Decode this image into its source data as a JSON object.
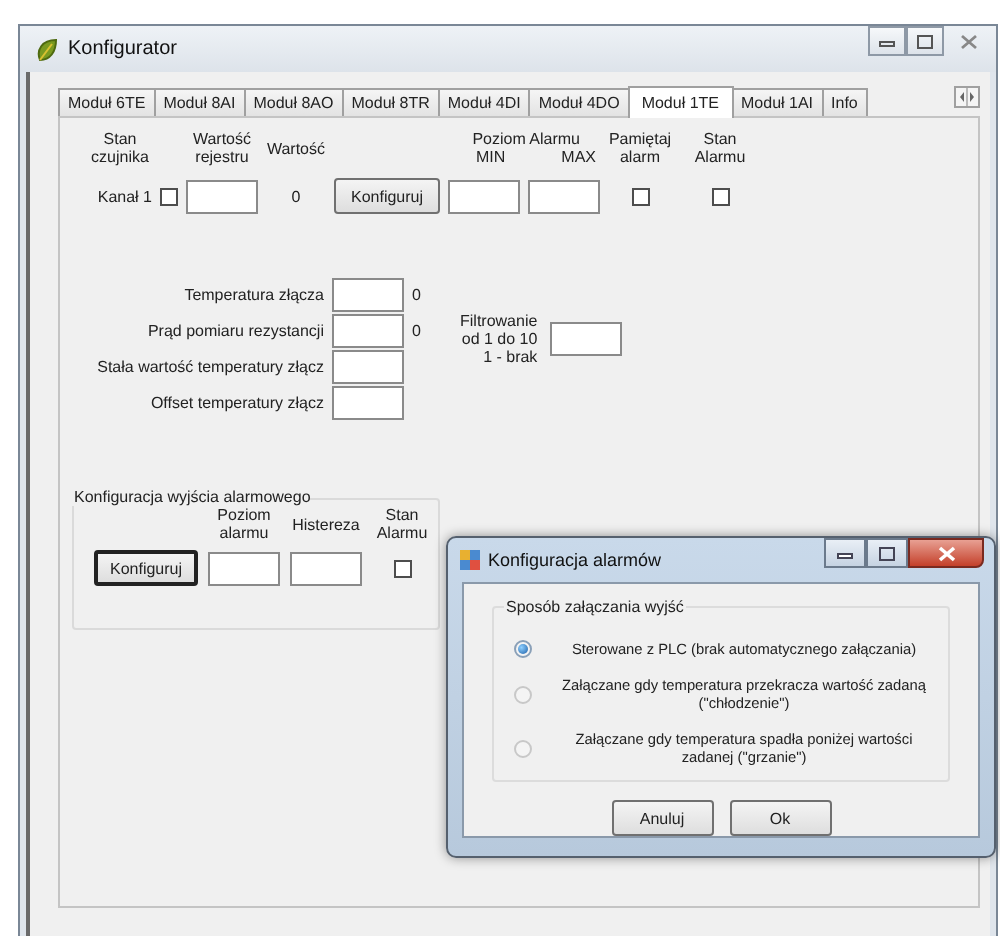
{
  "window": {
    "title": "Konfigurator"
  },
  "tabs": [
    {
      "label": "Moduł 6TE",
      "selected": false
    },
    {
      "label": "Moduł 8AI",
      "selected": false
    },
    {
      "label": "Moduł 8AO",
      "selected": false
    },
    {
      "label": "Moduł 8TR",
      "selected": false
    },
    {
      "label": "Moduł 4DI",
      "selected": false
    },
    {
      "label": "Moduł 4DO",
      "selected": false
    },
    {
      "label": "Moduł 1TE",
      "selected": true
    },
    {
      "label": "Moduł 1AI",
      "selected": false
    },
    {
      "label": "Info",
      "selected": false
    }
  ],
  "channel_section": {
    "headers": {
      "sensor_state": "Stan\nczujnika",
      "register_value": "Wartość\nrejestru",
      "value": "Wartość",
      "alarm_level": "Poziom Alarmu",
      "min": "MIN",
      "max": "MAX",
      "remember_alarm": "Pamiętaj\nalarm",
      "alarm_state": "Stan\nAlarmu"
    },
    "channel_label": "Kanał 1",
    "sensor_checked": false,
    "value": "0",
    "configure_button": "Konfiguruj",
    "remember_checked": false,
    "alarm_state_checked": false
  },
  "junction_section": {
    "fields": [
      {
        "label": "Temperatura złącza",
        "reading": "0"
      },
      {
        "label": "Prąd pomiaru rezystancji",
        "reading": "0"
      },
      {
        "label": "Stała wartość temperatury złącz"
      },
      {
        "label": "Offset temperatury złącz"
      }
    ],
    "filter_label": "Filtrowanie\nod 1 do 10\n1 - brak"
  },
  "alarm_output": {
    "title": "Konfiguracja wyjścia alarmowego",
    "level_header": "Poziom\nalarmu",
    "hysteresis_header": "Histereza",
    "state_header": "Stan\nAlarmu",
    "configure_button": "Konfiguruj",
    "state_checked": false
  },
  "dialog": {
    "title": "Konfiguracja alarmów",
    "group_title": "Sposób załączania wyjść",
    "options": [
      {
        "label": "Sterowane z PLC (brak automatycznego załączania)",
        "selected": true
      },
      {
        "label": "Załączane gdy temperatura przekracza wartość zadaną\n(\"chłodzenie\")",
        "selected": false
      },
      {
        "label": "Załączane gdy temperatura spadła poniżej wartości\nzadanej (\"grzanie\")",
        "selected": false
      }
    ],
    "buttons": [
      "Anuluj",
      "Ok"
    ]
  }
}
